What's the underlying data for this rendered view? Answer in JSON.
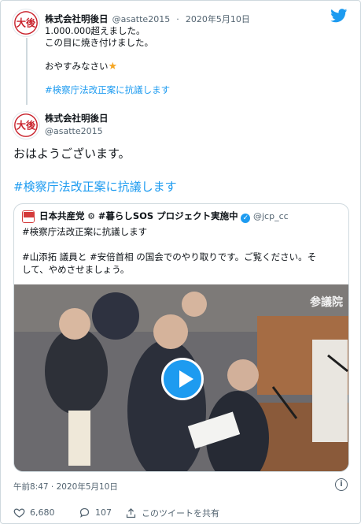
{
  "tweet1": {
    "author_name": "株式会社明後日",
    "author_handle": "@asatte2015",
    "separator": "·",
    "date": "2020年5月10日",
    "lines": [
      "1.000.000超えました。",
      "この目に焼き付けました。",
      "",
      "おやすみなさい"
    ],
    "star": "★",
    "hashtag": "#検察庁法改正案に抗議します"
  },
  "tweet2": {
    "author_name": "株式会社明後日",
    "author_handle": "@asatte2015",
    "text": "おはようございます。",
    "hashtag": "#検察庁法改正案に抗議します"
  },
  "quote": {
    "author_name": "日本共産党",
    "author_suffix": "#暮らしSOS プロジェクト実施中",
    "verified": "✓",
    "author_handle": "@jcp_cc",
    "hashtag_line": "#検察庁法改正案に抗議します",
    "body_line1": "#山添拓 議員と #安倍首相 の国会でのやり取りです。ご覧ください。そ",
    "body_line2": "して、やめさせましょう。",
    "video_watermark": "参議院"
  },
  "meta": {
    "timestamp": "午前8:47 · 2020年5月10日",
    "info_icon": "i"
  },
  "actions": {
    "likes": "6,680",
    "replies": "107",
    "share_label": "このツイートを共有"
  },
  "colors": {
    "accent": "#1d9bf0",
    "text": "#0f1419",
    "muted": "#536471",
    "border": "#cfd9de"
  },
  "icons": [
    "twitter-bird-icon",
    "heart-icon",
    "reply-icon",
    "share-icon",
    "info-icon",
    "play-icon",
    "verified-badge-icon"
  ]
}
